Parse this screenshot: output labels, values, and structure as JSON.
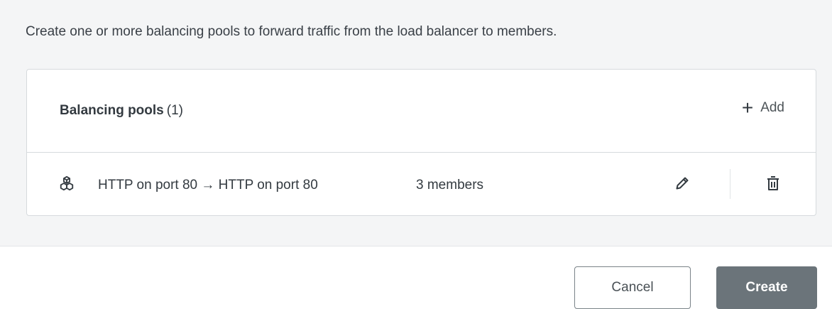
{
  "description": "Create one or more balancing pools to forward traffic from the load balancer to members.",
  "pools_card": {
    "title": "Balancing pools",
    "count": "(1)",
    "add_icon": "plus-icon",
    "add_label": "Add",
    "rows": [
      {
        "icon": "cubes-icon",
        "name": "HTTP on port 80 → HTTP on port 80",
        "members": "3 members",
        "edit_icon": "pencil-icon",
        "delete_icon": "trash-icon"
      }
    ]
  },
  "footer": {
    "cancel_label": "Cancel",
    "create_label": "Create"
  },
  "colors": {
    "body_background": "#f4f5f6",
    "card_border": "#d6dadd",
    "primary_button": "#6b747a",
    "text": "#333a40"
  }
}
